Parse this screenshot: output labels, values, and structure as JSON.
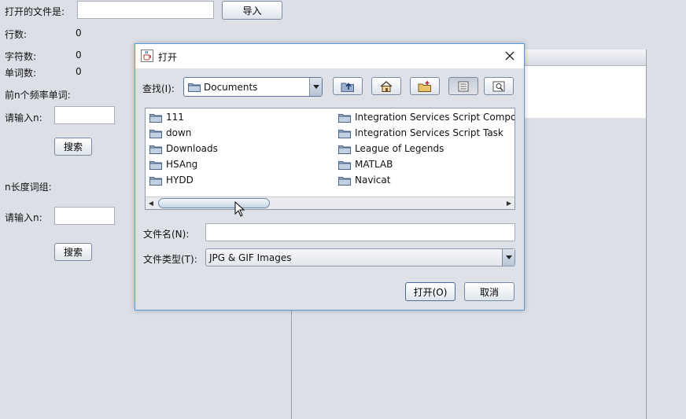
{
  "main": {
    "file_label": "打开的文件是:",
    "file_value": "",
    "import_button": "导入",
    "lines_label": "行数:",
    "lines_value": "0",
    "chars_label": "字符数:",
    "chars_value": "0",
    "words_label": "单词数:",
    "words_value": "0",
    "topn_label": "前n个频率单词:",
    "input_n_label1": "请输入n:",
    "input_n_value1": "",
    "search_button1": "搜索",
    "phrase_label": "n长度词组:",
    "input_n_label2": "请输入n:",
    "input_n_value2": "",
    "search_button2": "搜索"
  },
  "dialog": {
    "title": "打开",
    "lookin_label": "查找(I):",
    "lookin_value": "Documents",
    "filename_label": "文件名(N):",
    "filename_value": "",
    "filetype_label": "文件类型(T):",
    "filetype_value": "JPG & GIF Images",
    "open_button": "打开(O)",
    "cancel_button": "取消",
    "files_col1": [
      "111",
      "down",
      "Downloads",
      "HSAng",
      "HYDD"
    ],
    "files_col2": [
      "Integration Services Script Componer",
      "Integration Services Script Task",
      "League of Legends",
      "MATLAB",
      "Navicat"
    ]
  },
  "icons": {
    "up": "up-folder-icon",
    "home": "home-icon",
    "new_folder": "new-folder-icon",
    "list_view": "list-view-icon",
    "details_view": "details-view-icon",
    "folder": "folder-icon",
    "close": "close-icon"
  },
  "colors": {
    "accent": "#5b9bd5",
    "background": "#dcdfe6",
    "folder": "#7b94b5"
  }
}
